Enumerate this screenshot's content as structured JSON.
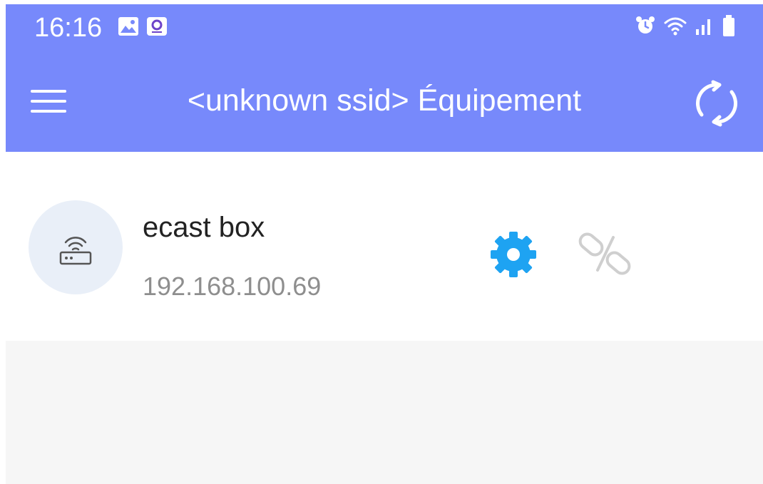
{
  "status_bar": {
    "time": "16:16",
    "left_icons": [
      "gallery-icon",
      "app-notification-icon"
    ],
    "right_icons": [
      "alarm-icon",
      "wifi-icon",
      "signal-icon",
      "battery-icon"
    ]
  },
  "app_bar": {
    "title": "<unknown ssid> Équipement",
    "menu_icon": "hamburger-menu-icon",
    "refresh_icon": "refresh-icon"
  },
  "devices": [
    {
      "name": "ecast box",
      "ip": "192.168.100.69",
      "icon": "router-icon",
      "actions": [
        "settings-gear-icon",
        "unlink-icon"
      ]
    }
  ],
  "colors": {
    "app_bar": "#7789fb",
    "accent": "#1ea3f2",
    "avatar_bg": "#e9eff8",
    "muted_text": "#8e8e8e",
    "page_bg": "#f6f6f6"
  }
}
